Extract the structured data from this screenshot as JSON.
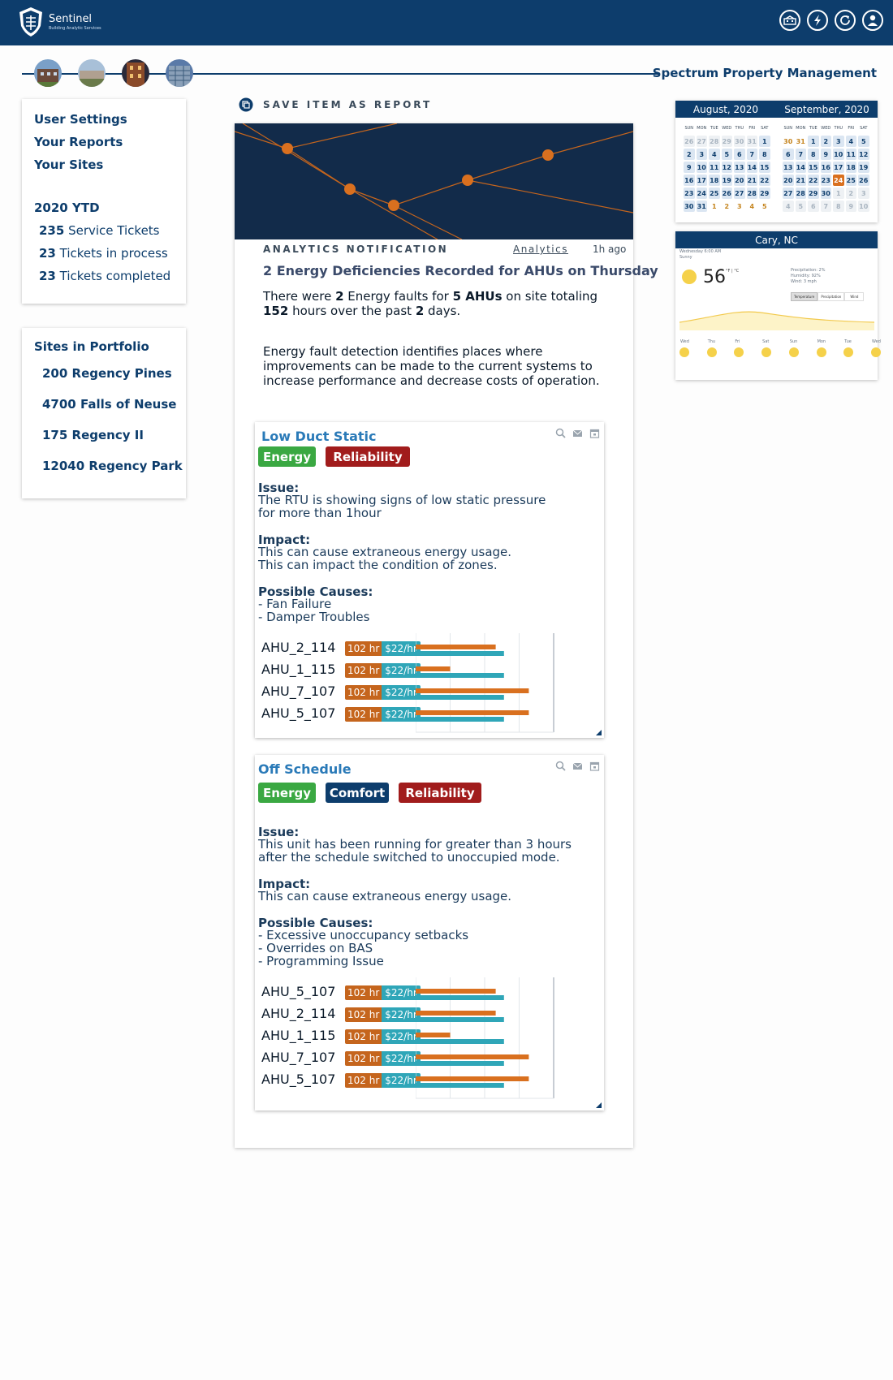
{
  "header": {
    "brand": "Sentinel",
    "brand_sub": "Building Analytic Services",
    "icons": [
      "building-icon",
      "lightning-icon",
      "refresh-icon",
      "user-icon"
    ]
  },
  "company": "Spectrum Property Management",
  "sidebar": {
    "links": [
      "User Settings",
      "Your Reports",
      "Your Sites"
    ],
    "ytd_title": "2020 YTD",
    "stats": [
      {
        "num": "235",
        "label": "Service Tickets"
      },
      {
        "num": "23",
        "label": "Tickets in process"
      },
      {
        "num": "23",
        "label": "Tickets completed"
      }
    ],
    "portfolio_title": "Sites in Portfolio",
    "sites": [
      "200 Regency Pines",
      "4700 Falls of Neuse",
      "175 Regency II",
      "12040 Regency Park"
    ]
  },
  "save_label": "SAVE ITEM AS REPORT",
  "notification": {
    "kind": "ANALYTICS NOTIFICATION",
    "link": "Analytics",
    "time": "1h ago",
    "title": "2 Energy Deficiencies Recorded for AHUs on Thursday",
    "summary": {
      "p1": "There were ",
      "n1": "2",
      "p2": " Energy faults for ",
      "n2": "5 AHUs",
      "p3": " on site totaling",
      "n3": "152",
      "p4": " hours over the past ",
      "n4": "2",
      "p5": " days."
    },
    "description": "Energy fault detection identifies places where improvements can be made to the current systems to increase performance and decrease costs of operation."
  },
  "issues": [
    {
      "title": "Low Duct Static",
      "tags": [
        {
          "label": "Energy",
          "color": "#3aa842"
        },
        {
          "label": "Reliability",
          "color": "#a11c1c"
        }
      ],
      "issue_label": "Issue:",
      "issue_lines": [
        "The RTU is showing signs of low static pressure",
        "for more than 1hour"
      ],
      "impact_label": "Impact:",
      "impact_lines": [
        "This can cause extraneous energy usage.",
        "This can impact the condition of zones."
      ],
      "causes_label": "Possible Causes:",
      "causes_lines": [
        "- Fan Failure",
        "- Damper Troubles"
      ],
      "rows": [
        {
          "unit": "AHU_2_114",
          "hours": "102 hr",
          "rate": "$22/hr"
        },
        {
          "unit": "AHU_1_115",
          "hours": "102 hr",
          "rate": "$22/hr"
        },
        {
          "unit": "AHU_7_107",
          "hours": "102 hr",
          "rate": "$22/hr"
        },
        {
          "unit": "AHU_5_107",
          "hours": "102 hr",
          "rate": "$22/hr"
        }
      ]
    },
    {
      "title": "Off Schedule",
      "tags": [
        {
          "label": "Energy",
          "color": "#3aa842"
        },
        {
          "label": "Comfort",
          "color": "#0d3d6c"
        },
        {
          "label": "Reliability",
          "color": "#a11c1c"
        }
      ],
      "issue_label": "Issue:",
      "issue_lines": [
        "This unit has been running for greater than 3 hours",
        "after the schedule switched to unoccupied mode."
      ],
      "impact_label": "Impact:",
      "impact_lines": [
        "This can cause extraneous energy usage."
      ],
      "causes_label": "Possible Causes:",
      "causes_lines": [
        "- Excessive unoccupancy setbacks",
        "- Overrides on BAS",
        "- Programming Issue"
      ],
      "rows": [
        {
          "unit": "AHU_5_107",
          "hours": "102 hr",
          "rate": "$22/hr"
        },
        {
          "unit": "AHU_2_114",
          "hours": "102 hr",
          "rate": "$22/hr"
        },
        {
          "unit": "AHU_1_115",
          "hours": "102 hr",
          "rate": "$22/hr"
        },
        {
          "unit": "AHU_7_107",
          "hours": "102 hr",
          "rate": "$22/hr"
        },
        {
          "unit": "AHU_5_107",
          "hours": "102 hr",
          "rate": "$22/hr"
        }
      ]
    }
  ],
  "chart_data": [
    {
      "type": "bar",
      "categories": [
        "AHU_2_114",
        "AHU_1_115",
        "AHU_7_107",
        "AHU_5_107"
      ],
      "series": [
        {
          "color": "#d9701f",
          "values": [
            0.58,
            0.25,
            0.82,
            0.82
          ]
        },
        {
          "color": "#2fa6b8",
          "values": [
            0.64,
            0.64,
            0.64,
            0.64
          ]
        }
      ]
    },
    {
      "type": "bar",
      "categories": [
        "AHU_5_107",
        "AHU_2_114",
        "AHU_1_115",
        "AHU_7_107",
        "AHU_5_107"
      ],
      "series": [
        {
          "color": "#d9701f",
          "values": [
            0.58,
            0.58,
            0.25,
            0.82,
            0.82
          ]
        },
        {
          "color": "#2fa6b8",
          "values": [
            0.64,
            0.64,
            0.64,
            0.64,
            0.64
          ]
        }
      ]
    }
  ],
  "calendar": {
    "months": [
      {
        "title": "August, 2020",
        "days": [
          [
            "26",
            "o"
          ],
          [
            "27",
            "o"
          ],
          [
            "28",
            "o"
          ],
          [
            "29",
            "o"
          ],
          [
            "30",
            "o"
          ],
          [
            "31",
            "o"
          ],
          [
            "1",
            ""
          ],
          [
            "2",
            ""
          ],
          [
            "3",
            ""
          ],
          [
            "4",
            ""
          ],
          [
            "5",
            ""
          ],
          [
            "6",
            ""
          ],
          [
            "7",
            ""
          ],
          [
            "8",
            ""
          ],
          [
            "9",
            ""
          ],
          [
            "10",
            ""
          ],
          [
            "11",
            ""
          ],
          [
            "12",
            ""
          ],
          [
            "13",
            ""
          ],
          [
            "14",
            ""
          ],
          [
            "15",
            ""
          ],
          [
            "16",
            ""
          ],
          [
            "17",
            ""
          ],
          [
            "18",
            ""
          ],
          [
            "19",
            ""
          ],
          [
            "20",
            ""
          ],
          [
            "21",
            ""
          ],
          [
            "22",
            ""
          ],
          [
            "23",
            ""
          ],
          [
            "24",
            ""
          ],
          [
            "25",
            ""
          ],
          [
            "26",
            ""
          ],
          [
            "27",
            ""
          ],
          [
            "28",
            ""
          ],
          [
            "29",
            ""
          ],
          [
            "30",
            ""
          ],
          [
            "31",
            ""
          ],
          [
            "1",
            "n"
          ],
          [
            "2",
            "n"
          ],
          [
            "3",
            "n"
          ],
          [
            "4",
            "n"
          ],
          [
            "5",
            "n"
          ]
        ]
      },
      {
        "title": "September, 2020",
        "days": [
          [
            "30",
            "n"
          ],
          [
            "31",
            "n"
          ],
          [
            "1",
            ""
          ],
          [
            "2",
            ""
          ],
          [
            "3",
            ""
          ],
          [
            "4",
            ""
          ],
          [
            "5",
            ""
          ],
          [
            "6",
            ""
          ],
          [
            "7",
            ""
          ],
          [
            "8",
            ""
          ],
          [
            "9",
            ""
          ],
          [
            "10",
            ""
          ],
          [
            "11",
            ""
          ],
          [
            "12",
            ""
          ],
          [
            "13",
            ""
          ],
          [
            "14",
            ""
          ],
          [
            "15",
            ""
          ],
          [
            "16",
            ""
          ],
          [
            "17",
            ""
          ],
          [
            "18",
            ""
          ],
          [
            "19",
            ""
          ],
          [
            "20",
            ""
          ],
          [
            "21",
            ""
          ],
          [
            "22",
            ""
          ],
          [
            "23",
            ""
          ],
          [
            "24",
            "s"
          ],
          [
            "25",
            ""
          ],
          [
            "26",
            ""
          ],
          [
            "27",
            ""
          ],
          [
            "28",
            ""
          ],
          [
            "29",
            ""
          ],
          [
            "30",
            ""
          ],
          [
            "1",
            "o"
          ],
          [
            "2",
            "o"
          ],
          [
            "3",
            "o"
          ],
          [
            "4",
            "o"
          ],
          [
            "5",
            "o"
          ],
          [
            "6",
            "o"
          ],
          [
            "7",
            "o"
          ],
          [
            "8",
            "o"
          ],
          [
            "9",
            "o"
          ],
          [
            "10",
            "o"
          ]
        ]
      }
    ],
    "weekdays": [
      "SUN",
      "MON",
      "TUE",
      "WED",
      "THU",
      "FRI",
      "SAT"
    ]
  },
  "weather": {
    "location": "Cary, NC",
    "time": "Wednesday 6:00 AM",
    "condition": "Sunny",
    "temp": "56",
    "unit": "°F | °C",
    "precip": "Precipitation: 2%",
    "humidity": "Humidity: 92%",
    "wind": "Wind: 3 mph",
    "tabs": [
      "Temperature",
      "Precipitation",
      "Wind"
    ],
    "days": [
      "Wed",
      "Thu",
      "Fri",
      "Sat",
      "Sun",
      "Mon",
      "Tue",
      "Wed"
    ]
  }
}
